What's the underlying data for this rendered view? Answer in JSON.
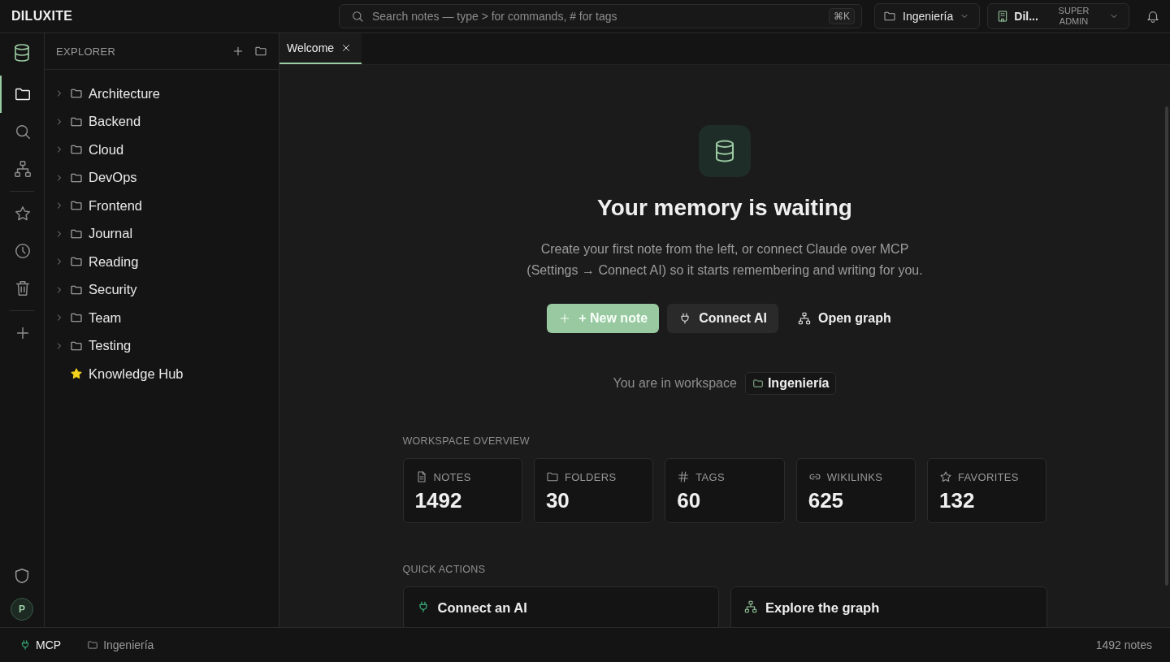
{
  "app": {
    "title": "DILUXITE"
  },
  "search": {
    "placeholder": "Search notes — type > for commands, # for tags",
    "shortcut": "⌘K"
  },
  "workspace_picker": {
    "label": "Ingeniería"
  },
  "account": {
    "name": "Dil...",
    "role": "SUPER ADMIN"
  },
  "activity_bar": {
    "items": [
      {
        "kind": "folder",
        "selected": true
      },
      {
        "kind": "search",
        "selected": false
      },
      {
        "kind": "graph",
        "selected": false
      },
      {
        "kind": "star",
        "selected": false
      },
      {
        "kind": "clock",
        "selected": false
      },
      {
        "kind": "trash",
        "selected": false
      },
      {
        "kind": "plus",
        "selected": false
      }
    ],
    "avatar": "P"
  },
  "explorer": {
    "title": "EXPLORER",
    "items": [
      {
        "kind": "folder",
        "label": "Architecture",
        "expanded": false
      },
      {
        "kind": "folder",
        "label": "Backend",
        "expanded": false
      },
      {
        "kind": "folder",
        "label": "Cloud",
        "expanded": false
      },
      {
        "kind": "folder",
        "label": "DevOps",
        "expanded": false
      },
      {
        "kind": "folder",
        "label": "Frontend",
        "expanded": false
      },
      {
        "kind": "folder",
        "label": "Journal",
        "expanded": false
      },
      {
        "kind": "folder",
        "label": "Reading",
        "expanded": false
      },
      {
        "kind": "folder",
        "label": "Security",
        "expanded": false
      },
      {
        "kind": "folder",
        "label": "Team",
        "expanded": false
      },
      {
        "kind": "folder",
        "label": "Testing",
        "expanded": false
      },
      {
        "kind": "favorite",
        "label": "Knowledge Hub"
      }
    ]
  },
  "tabs": [
    {
      "label": "Welcome",
      "selected": true
    }
  ],
  "welcome": {
    "heading": "Your memory is waiting",
    "text": "Create your first note from the left, or connect Claude over MCP (Settings → Connect AI) so it starts remembering and writing for you.",
    "buttons": [
      {
        "kind": "primary",
        "label": "+ New note"
      },
      {
        "kind": "secondary",
        "label": "Connect AI"
      },
      {
        "kind": "ghost",
        "label": "Open graph"
      }
    ],
    "workspace_text": "You are in workspace",
    "workspace": "Ingeniería"
  },
  "overview": {
    "title": "WORKSPACE OVERVIEW",
    "stats": [
      {
        "kind": "notes",
        "label": "NOTES",
        "value": "1492"
      },
      {
        "kind": "folders",
        "label": "FOLDERS",
        "value": "30"
      },
      {
        "kind": "tags",
        "label": "TAGS",
        "value": "60"
      },
      {
        "kind": "links",
        "label": "WIKILINKS",
        "value": "625"
      },
      {
        "kind": "favorites",
        "label": "FAVORITES",
        "value": "132"
      }
    ]
  },
  "quick_actions": {
    "title": "QUICK ACTIONS",
    "cards": [
      {
        "kind": "connect",
        "title": "Connect an AI"
      },
      {
        "kind": "graph",
        "title": "Explore the graph"
      }
    ]
  },
  "status_bar": {
    "mcp": "MCP",
    "workspace": "Ingeniería",
    "count": "1492 notes"
  }
}
